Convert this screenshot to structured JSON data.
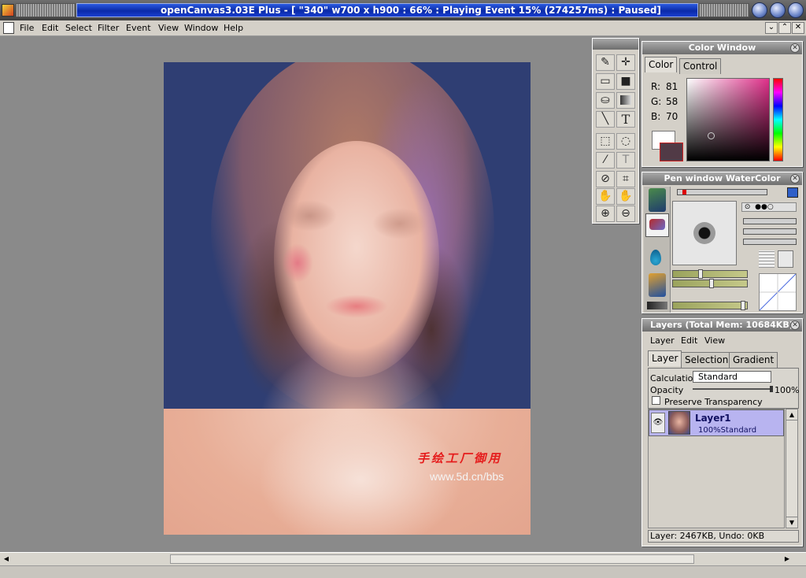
{
  "window": {
    "title": "openCanvas3.03E Plus - [ \"340\" w700 x h900 : 66% : Playing Event 15% (274257ms) : Paused]"
  },
  "menu": [
    "File",
    "Edit",
    "Select",
    "Filter",
    "Event",
    "View",
    "Window",
    "Help"
  ],
  "mdi_buttons": [
    "⌄",
    "⌃",
    "✕"
  ],
  "canvas": {
    "watermark_cn": "手绘工厂御用",
    "watermark_url": "www.5d.cn/bbs"
  },
  "toolbox": {
    "tools": [
      "pen-icon",
      "move-icon",
      "rectangle-icon",
      "fill-rect-icon",
      "bucket-icon",
      "gradient-icon",
      "line-icon",
      "text-icon",
      "marquee-icon",
      "lasso-icon",
      "magic-wand-icon",
      "text-select-icon",
      "eyedropper-icon",
      "crop-icon",
      "hand-icon",
      "rotate-hand-icon",
      "zoom-in-icon",
      "zoom-out-icon"
    ],
    "text_glyph": "T"
  },
  "color_window": {
    "title": "Color Window",
    "tabs": [
      "Color",
      "Control"
    ],
    "r_label": "R:",
    "r": "81",
    "g_label": "G:",
    "g": "58",
    "b_label": "B:",
    "b": "70",
    "current_color": "#513a46"
  },
  "pen_window": {
    "title": "Pen window  WaterColor"
  },
  "layers": {
    "title": "Layers (Total Mem: 10684KB)",
    "menu": [
      "Layer",
      "Edit",
      "View"
    ],
    "tabs": [
      "Layer",
      "Selection",
      "Gradient"
    ],
    "calculation_label": "Calculation",
    "calculation_value": "Standard",
    "opacity_label": "Opacity",
    "opacity_value": "100%",
    "preserve_label": "Preserve Transparency",
    "items": [
      {
        "name": "Layer1",
        "detail": "100%Standard"
      }
    ],
    "status": "Layer: 2467KB, Undo: 0KB"
  }
}
